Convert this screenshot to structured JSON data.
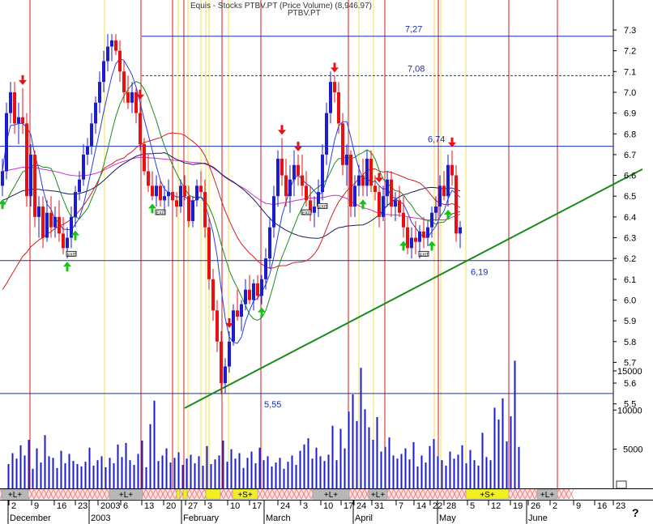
{
  "header": {
    "title": "Equis - Stocks PTBV.PT (Price Volume) (8,946.97)",
    "symbol": "PTBV.PT"
  },
  "colors": {
    "bull_candle": "#1c1cd0",
    "bear_candle": "#e81010",
    "trendline": "#1a8a1a",
    "level_line": "#1a2fb4",
    "ma_magenta": "#cc33cc",
    "ma_navy": "#1a1a60",
    "ma_red": "#d42020",
    "ma_green": "#1e8a1e",
    "ma_blue": "#2840e0",
    "volume": "#1c1cd0",
    "signal_up": "#18c018",
    "signal_down": "#e81010",
    "vline_red": "#d01818",
    "vline_yellow": "#e8e050"
  },
  "chart_data": {
    "type": "candlestick",
    "y_axis": {
      "min": 5.4,
      "max": 7.4,
      "ticks": [
        5.5,
        5.6,
        5.7,
        5.8,
        5.9,
        6.0,
        6.1,
        6.2,
        6.3,
        6.4,
        6.5,
        6.6,
        6.7,
        6.8,
        6.9,
        7.0,
        7.1,
        7.2,
        7.3
      ]
    },
    "volume_axis": {
      "max": 17000,
      "ticks": [
        5000,
        10000,
        15000
      ]
    },
    "x_axis": {
      "day_labels": [
        "2",
        "9",
        "16",
        "23",
        "2003",
        "6",
        "13",
        "20",
        "27",
        "3",
        "10",
        "17",
        "24",
        "3",
        "10",
        "17",
        "24",
        "31",
        "7",
        "14",
        "22",
        "28",
        "5",
        "12",
        "19",
        "26",
        "2",
        "9",
        "16",
        "23"
      ],
      "month_labels": [
        "December",
        "2003",
        "February",
        "March",
        "April",
        "May",
        "June"
      ]
    },
    "levels": [
      {
        "value": 7.27,
        "label": "7,27",
        "style": "solid"
      },
      {
        "value": 7.08,
        "label": "7,08",
        "style": "dashed"
      },
      {
        "value": 6.74,
        "label": "6,74",
        "style": "solid"
      },
      {
        "value": 6.19,
        "label": "6,19",
        "style": "solid"
      },
      {
        "value": 5.55,
        "label": "5,55",
        "style": "solid"
      }
    ],
    "trendline": {
      "from": {
        "bar": 43,
        "value": 5.48
      },
      "to": {
        "bar": 157,
        "value": 6.63
      }
    },
    "bars": [
      {
        "o": 6.55,
        "h": 6.68,
        "l": 6.5,
        "c": 6.62
      },
      {
        "o": 6.62,
        "h": 6.95,
        "l": 6.58,
        "c": 6.9
      },
      {
        "o": 6.9,
        "h": 7.05,
        "l": 6.85,
        "c": 7.0
      },
      {
        "o": 7.0,
        "h": 7.05,
        "l": 6.8,
        "c": 6.85
      },
      {
        "o": 6.85,
        "h": 6.95,
        "l": 6.75,
        "c": 6.88
      },
      {
        "o": 6.88,
        "h": 7.02,
        "l": 6.8,
        "c": 6.85
      },
      {
        "o": 6.85,
        "h": 6.9,
        "l": 6.45,
        "c": 6.5
      },
      {
        "o": 6.5,
        "h": 6.75,
        "l": 6.45,
        "c": 6.7
      },
      {
        "o": 6.7,
        "h": 6.72,
        "l": 6.35,
        "c": 6.4
      },
      {
        "o": 6.4,
        "h": 6.5,
        "l": 6.3,
        "c": 6.45
      },
      {
        "o": 6.45,
        "h": 6.5,
        "l": 6.25,
        "c": 6.3
      },
      {
        "o": 6.3,
        "h": 6.48,
        "l": 6.28,
        "c": 6.42
      },
      {
        "o": 6.42,
        "h": 6.5,
        "l": 6.3,
        "c": 6.35
      },
      {
        "o": 6.35,
        "h": 6.45,
        "l": 6.3,
        "c": 6.4
      },
      {
        "o": 6.4,
        "h": 6.48,
        "l": 6.28,
        "c": 6.32
      },
      {
        "o": 6.32,
        "h": 6.4,
        "l": 6.22,
        "c": 6.25
      },
      {
        "o": 6.25,
        "h": 6.35,
        "l": 6.2,
        "c": 6.3
      },
      {
        "o": 6.3,
        "h": 6.45,
        "l": 6.25,
        "c": 6.4
      },
      {
        "o": 6.4,
        "h": 6.55,
        "l": 6.35,
        "c": 6.52
      },
      {
        "o": 6.52,
        "h": 6.62,
        "l": 6.48,
        "c": 6.58
      },
      {
        "o": 6.58,
        "h": 6.75,
        "l": 6.55,
        "c": 6.7
      },
      {
        "o": 6.7,
        "h": 6.78,
        "l": 6.65,
        "c": 6.74
      },
      {
        "o": 6.74,
        "h": 6.9,
        "l": 6.7,
        "c": 6.85
      },
      {
        "o": 6.85,
        "h": 6.98,
        "l": 6.8,
        "c": 6.95
      },
      {
        "o": 6.95,
        "h": 7.1,
        "l": 6.9,
        "c": 7.05
      },
      {
        "o": 7.05,
        "h": 7.2,
        "l": 7.0,
        "c": 7.15
      },
      {
        "o": 7.15,
        "h": 7.28,
        "l": 7.1,
        "c": 7.22
      },
      {
        "o": 7.22,
        "h": 7.28,
        "l": 7.15,
        "c": 7.25
      },
      {
        "o": 7.25,
        "h": 7.28,
        "l": 7.18,
        "c": 7.2
      },
      {
        "o": 7.2,
        "h": 7.25,
        "l": 7.05,
        "c": 7.1
      },
      {
        "o": 7.1,
        "h": 7.15,
        "l": 6.95,
        "c": 7.0
      },
      {
        "o": 7.0,
        "h": 7.08,
        "l": 6.92,
        "c": 6.95
      },
      {
        "o": 6.95,
        "h": 7.05,
        "l": 6.9,
        "c": 7.0
      },
      {
        "o": 7.0,
        "h": 7.02,
        "l": 6.85,
        "c": 6.9
      },
      {
        "o": 6.9,
        "h": 6.95,
        "l": 6.72,
        "c": 6.75
      },
      {
        "o": 6.75,
        "h": 6.78,
        "l": 6.6,
        "c": 6.62
      },
      {
        "o": 6.62,
        "h": 6.7,
        "l": 6.52,
        "c": 6.55
      },
      {
        "o": 6.55,
        "h": 6.62,
        "l": 6.48,
        "c": 6.5
      },
      {
        "o": 6.5,
        "h": 6.6,
        "l": 6.45,
        "c": 6.55
      },
      {
        "o": 6.55,
        "h": 6.58,
        "l": 6.45,
        "c": 6.48
      },
      {
        "o": 6.48,
        "h": 6.55,
        "l": 6.42,
        "c": 6.5
      },
      {
        "o": 6.5,
        "h": 6.58,
        "l": 6.45,
        "c": 6.52
      },
      {
        "o": 6.52,
        "h": 6.55,
        "l": 6.45,
        "c": 6.48
      },
      {
        "o": 6.48,
        "h": 6.52,
        "l": 6.4,
        "c": 6.45
      },
      {
        "o": 6.45,
        "h": 6.58,
        "l": 6.42,
        "c": 6.55
      },
      {
        "o": 6.55,
        "h": 6.6,
        "l": 6.48,
        "c": 6.5
      },
      {
        "o": 6.5,
        "h": 6.55,
        "l": 6.35,
        "c": 6.38
      },
      {
        "o": 6.38,
        "h": 6.5,
        "l": 6.35,
        "c": 6.48
      },
      {
        "o": 6.48,
        "h": 6.58,
        "l": 6.45,
        "c": 6.55
      },
      {
        "o": 6.55,
        "h": 6.62,
        "l": 6.5,
        "c": 6.52
      },
      {
        "o": 6.52,
        "h": 6.58,
        "l": 6.3,
        "c": 6.35
      },
      {
        "o": 6.35,
        "h": 6.4,
        "l": 6.05,
        "c": 6.1
      },
      {
        "o": 6.1,
        "h": 6.15,
        "l": 5.9,
        "c": 5.95
      },
      {
        "o": 5.95,
        "h": 6.0,
        "l": 5.75,
        "c": 5.8
      },
      {
        "o": 5.8,
        "h": 5.85,
        "l": 5.55,
        "c": 5.6
      },
      {
        "o": 5.6,
        "h": 5.72,
        "l": 5.55,
        "c": 5.68
      },
      {
        "o": 5.68,
        "h": 5.85,
        "l": 5.65,
        "c": 5.8
      },
      {
        "o": 5.8,
        "h": 5.98,
        "l": 5.78,
        "c": 5.95
      },
      {
        "o": 5.95,
        "h": 6.05,
        "l": 5.9,
        "c": 5.92
      },
      {
        "o": 5.92,
        "h": 6.0,
        "l": 5.85,
        "c": 5.98
      },
      {
        "o": 5.98,
        "h": 6.1,
        "l": 5.95,
        "c": 6.05
      },
      {
        "o": 6.05,
        "h": 6.12,
        "l": 5.98,
        "c": 6.0
      },
      {
        "o": 6.0,
        "h": 6.1,
        "l": 5.95,
        "c": 6.08
      },
      {
        "o": 6.08,
        "h": 6.12,
        "l": 6.0,
        "c": 6.02
      },
      {
        "o": 6.02,
        "h": 6.12,
        "l": 5.98,
        "c": 6.1
      },
      {
        "o": 6.1,
        "h": 6.25,
        "l": 6.05,
        "c": 6.2
      },
      {
        "o": 6.2,
        "h": 6.4,
        "l": 6.15,
        "c": 6.35
      },
      {
        "o": 6.35,
        "h": 6.55,
        "l": 6.3,
        "c": 6.5
      },
      {
        "o": 6.5,
        "h": 6.72,
        "l": 6.45,
        "c": 6.68
      },
      {
        "o": 6.68,
        "h": 6.78,
        "l": 6.55,
        "c": 6.6
      },
      {
        "o": 6.6,
        "h": 6.68,
        "l": 6.45,
        "c": 6.5
      },
      {
        "o": 6.5,
        "h": 6.65,
        "l": 6.42,
        "c": 6.58
      },
      {
        "o": 6.58,
        "h": 6.72,
        "l": 6.5,
        "c": 6.65
      },
      {
        "o": 6.65,
        "h": 6.7,
        "l": 6.55,
        "c": 6.6
      },
      {
        "o": 6.6,
        "h": 6.7,
        "l": 6.5,
        "c": 6.55
      },
      {
        "o": 6.55,
        "h": 6.62,
        "l": 6.45,
        "c": 6.48
      },
      {
        "o": 6.48,
        "h": 6.55,
        "l": 6.38,
        "c": 6.42
      },
      {
        "o": 6.42,
        "h": 6.5,
        "l": 6.35,
        "c": 6.45
      },
      {
        "o": 6.45,
        "h": 6.58,
        "l": 6.4,
        "c": 6.52
      },
      {
        "o": 6.52,
        "h": 6.75,
        "l": 6.48,
        "c": 6.7
      },
      {
        "o": 6.7,
        "h": 6.95,
        "l": 6.65,
        "c": 6.9
      },
      {
        "o": 6.9,
        "h": 7.1,
        "l": 6.85,
        "c": 7.05
      },
      {
        "o": 7.05,
        "h": 7.08,
        "l": 6.95,
        "c": 7.0
      },
      {
        "o": 7.0,
        "h": 7.05,
        "l": 6.8,
        "c": 6.85
      },
      {
        "o": 6.85,
        "h": 6.9,
        "l": 6.6,
        "c": 6.65
      },
      {
        "o": 6.65,
        "h": 6.75,
        "l": 6.55,
        "c": 6.7
      },
      {
        "o": 6.7,
        "h": 6.72,
        "l": 6.4,
        "c": 6.45
      },
      {
        "o": 6.45,
        "h": 6.6,
        "l": 6.4,
        "c": 6.55
      },
      {
        "o": 6.55,
        "h": 6.65,
        "l": 6.5,
        "c": 6.6
      },
      {
        "o": 6.6,
        "h": 6.68,
        "l": 6.5,
        "c": 6.55
      },
      {
        "o": 6.55,
        "h": 6.72,
        "l": 6.5,
        "c": 6.68
      },
      {
        "o": 6.68,
        "h": 6.72,
        "l": 6.52,
        "c": 6.55
      },
      {
        "o": 6.55,
        "h": 6.6,
        "l": 6.48,
        "c": 6.52
      },
      {
        "o": 6.52,
        "h": 6.55,
        "l": 6.35,
        "c": 6.4
      },
      {
        "o": 6.4,
        "h": 6.55,
        "l": 6.38,
        "c": 6.5
      },
      {
        "o": 6.5,
        "h": 6.62,
        "l": 6.45,
        "c": 6.58
      },
      {
        "o": 6.58,
        "h": 6.62,
        "l": 6.4,
        "c": 6.45
      },
      {
        "o": 6.45,
        "h": 6.52,
        "l": 6.38,
        "c": 6.48
      },
      {
        "o": 6.48,
        "h": 6.55,
        "l": 6.4,
        "c": 6.42
      },
      {
        "o": 6.42,
        "h": 6.5,
        "l": 6.3,
        "c": 6.35
      },
      {
        "o": 6.35,
        "h": 6.4,
        "l": 6.22,
        "c": 6.25
      },
      {
        "o": 6.25,
        "h": 6.35,
        "l": 6.2,
        "c": 6.3
      },
      {
        "o": 6.3,
        "h": 6.38,
        "l": 6.22,
        "c": 6.28
      },
      {
        "o": 6.28,
        "h": 6.36,
        "l": 6.2,
        "c": 6.33
      },
      {
        "o": 6.33,
        "h": 6.4,
        "l": 6.25,
        "c": 6.3
      },
      {
        "o": 6.3,
        "h": 6.38,
        "l": 6.26,
        "c": 6.35
      },
      {
        "o": 6.35,
        "h": 6.45,
        "l": 6.3,
        "c": 6.42
      },
      {
        "o": 6.42,
        "h": 6.5,
        "l": 6.38,
        "c": 6.45
      },
      {
        "o": 6.45,
        "h": 6.6,
        "l": 6.4,
        "c": 6.55
      },
      {
        "o": 6.55,
        "h": 6.62,
        "l": 6.48,
        "c": 6.5
      },
      {
        "o": 6.5,
        "h": 6.7,
        "l": 6.45,
        "c": 6.65
      },
      {
        "o": 6.65,
        "h": 6.72,
        "l": 6.55,
        "c": 6.6
      },
      {
        "o": 6.6,
        "h": 6.65,
        "l": 6.28,
        "c": 6.32
      },
      {
        "o": 6.32,
        "h": 6.38,
        "l": 6.25,
        "c": 6.35
      }
    ],
    "volumes": [
      3100,
      4500,
      3800,
      5500,
      4200,
      6200,
      2500,
      5100,
      3300,
      6800,
      4100,
      3900,
      2600,
      4800,
      3200,
      4400,
      3500,
      3100,
      2800,
      3400,
      5200,
      2900,
      3600,
      4100,
      2700,
      3900,
      3200,
      5600,
      4000,
      5800,
      3600,
      3000,
      4400,
      6100,
      2700,
      8200,
      11200,
      3500,
      4200,
      5100,
      3300,
      3900,
      4600,
      3000,
      3800,
      4300,
      3200,
      4100,
      2900,
      5400,
      3100,
      3700,
      4200,
      6100,
      3400,
      5000,
      3800,
      4500,
      2600,
      3900,
      4700,
      3200,
      5200,
      3600,
      4100,
      2800,
      3300,
      3900,
      2500,
      3400,
      4200,
      3000,
      4800,
      5600,
      6400,
      3800,
      5200,
      4100,
      3500,
      4300,
      8000,
      3600,
      7600,
      5100,
      9800,
      12000,
      8600,
      15400,
      10100,
      7800,
      6200,
      9100,
      4700,
      5300,
      6500,
      4200,
      3800,
      4400,
      5100,
      3700,
      5900,
      2800,
      4200,
      3300,
      5400,
      6300,
      4100,
      3600,
      2900,
      4700,
      3800,
      4300,
      5500,
      3200,
      4900,
      3600,
      2900,
      7100,
      4000,
      3600,
      10300,
      8800,
      11500,
      6000,
      9200,
      16300,
      5300
    ]
  },
  "signals": {
    "up_label": "up-arrow",
    "down_label": "down-arrow",
    "exit_label": "EXIT"
  },
  "bands": [
    {
      "label": "+L+",
      "color": "#b8b8b8"
    },
    {
      "label": "+L+",
      "color": "#b8b8b8"
    },
    {
      "label": "+S+",
      "color": "#f0f020"
    },
    {
      "label": "+L+",
      "color": "#b8b8b8"
    },
    {
      "label": "+L+",
      "color": "#b8b8b8"
    },
    {
      "label": "+S+",
      "color": "#f0f020"
    },
    {
      "label": "+L+",
      "color": "#b8b8b8"
    }
  ]
}
